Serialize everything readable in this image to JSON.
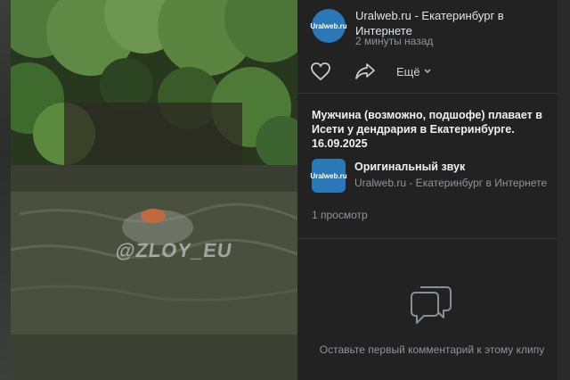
{
  "post": {
    "author": "Uralweb.ru - Екатеринбург в Интернете",
    "avatar_text": "Uralweb.ru",
    "time": "2 минуты назад",
    "more_label": "Ещё",
    "description": "Мужчина (возможно, подшофе) плавает в Исети у дендрария в Екатеринбурге. 16.09.2025",
    "views": "1 просмотр"
  },
  "audio": {
    "title": "Оригинальный звук",
    "subtitle": "Uralweb.ru - Екатеринбург в Интернете",
    "avatar_text": "Uralweb.ru"
  },
  "comments": {
    "empty_text": "Оставьте первый комментарий к этому клипу"
  },
  "video": {
    "watermark": "@ZLOY_EU"
  },
  "colors": {
    "panel_bg": "#222222",
    "brand_blue": "#2a78b8",
    "text_secondary": "#909499"
  },
  "icons": [
    "heart-icon",
    "share-icon",
    "chevron-down-icon",
    "comments-icon"
  ]
}
